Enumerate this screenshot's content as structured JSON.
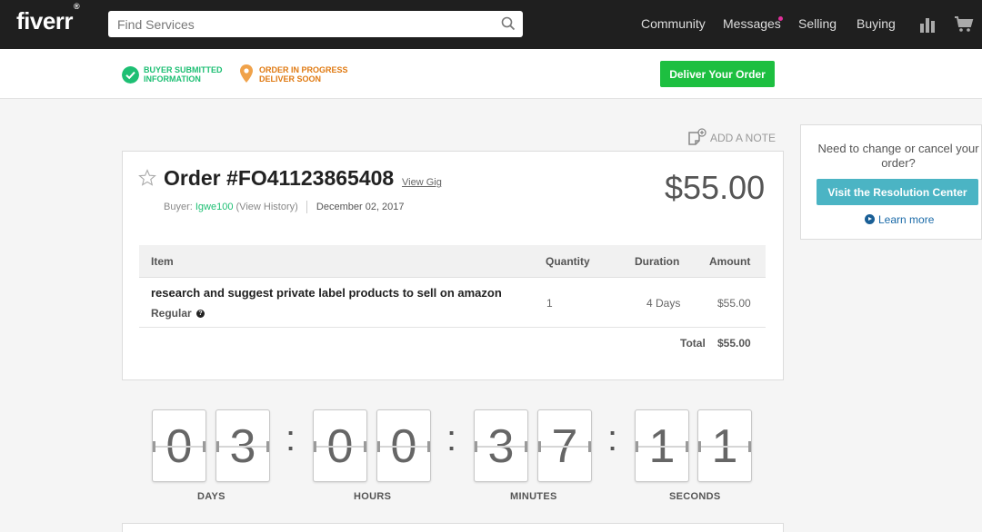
{
  "header": {
    "logo": "fiverr",
    "logo_mark": "®",
    "search_placeholder": "Find Services",
    "nav": [
      "Community",
      "Messages",
      "Selling",
      "Buying"
    ],
    "accent_color": "#1dbf73",
    "notification_dot_color": "#e0309a"
  },
  "progress": {
    "step1": {
      "line1": "BUYER SUBMITTED",
      "line2": "INFORMATION",
      "color": "#1dbf73"
    },
    "step2": {
      "line1": "ORDER IN PROGRESS",
      "line2": "DELIVER SOON",
      "color": "#e07a12"
    },
    "deliver_button": "Deliver Your Order"
  },
  "add_note": "ADD A NOTE",
  "order": {
    "title": "Order #FO41123865408",
    "view_gig": "View Gig",
    "price": "$55.00",
    "buyer_prefix": "Buyer:",
    "buyer_name": "Igwe100",
    "view_history": "(View History)",
    "date": "December 02, 2017",
    "columns": [
      "Item",
      "Quantity",
      "Duration",
      "Amount"
    ],
    "item_name": "research and suggest private label products to sell on amazon",
    "item_tier": "Regular",
    "quantity": "1",
    "duration": "4 Days",
    "amount": "$55.00",
    "total_label": "Total",
    "total_value": "$55.00"
  },
  "side": {
    "question": "Need to change or cancel your order?",
    "button": "Visit the Resolution Center",
    "learn_more": "Learn more"
  },
  "countdown": {
    "digits": [
      "0",
      "3",
      "0",
      "0",
      "3",
      "7",
      "1",
      "1"
    ],
    "separator": ":",
    "units": [
      "DAYS",
      "HOURS",
      "MINUTES",
      "SECONDS"
    ]
  }
}
